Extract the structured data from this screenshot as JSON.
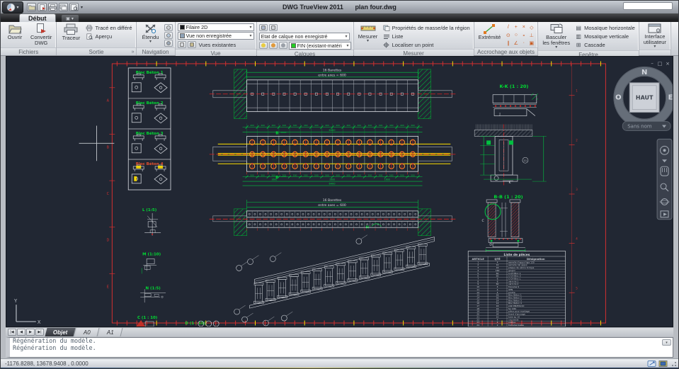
{
  "titlebar": {
    "app": "DWG TrueView 2011",
    "doc": "plan four.dwg"
  },
  "tabs": {
    "ribbon_tab": "Début"
  },
  "ribbon": {
    "fichiers": {
      "label": "Fichiers",
      "ouvrir": "Ouvrir",
      "convertir_1": "Convertir",
      "convertir_2": "DWG"
    },
    "sortie": {
      "label": "Sortie",
      "more": "»",
      "traceur": "Traceur",
      "trace": "Tracé en différé",
      "apercu": "Aperçu"
    },
    "navigation": {
      "label": "Navigation",
      "etendu": "Étendu"
    },
    "vue": {
      "label": "Vue",
      "style": "Filaire 2D",
      "vue_combo": "Vue non enregistrée",
      "existantes": "Vues existantes"
    },
    "calques": {
      "label": "Calques",
      "etat": "Etat de calque non enregistré",
      "calque": "FIN (existant-matéri",
      "layer_color": "#22cc22"
    },
    "mesurer": {
      "label": "Mesurer",
      "btn": "Mesurer",
      "props": "Propriétés de masse/de la région",
      "liste": "Liste",
      "localiser": "Localiser un point"
    },
    "accrochage": {
      "label": "Accrochage aux objets",
      "extremite": "Extrémité",
      "glyphs": [
        "/",
        "+",
        "×",
        "◇",
        "⊙",
        "○",
        "∘",
        "⊥",
        "∥",
        "∠",
        "·",
        "▣"
      ]
    },
    "fenetre": {
      "label": "Fenêtre",
      "basculer_1": "Basculer",
      "basculer_2": "les fenêtres",
      "items": [
        {
          "icon": "▤",
          "label": "Mosaïque horizontale"
        },
        {
          "icon": "▥",
          "label": "Mosaïque verticale"
        },
        {
          "icon": "⊞",
          "label": "Cascade"
        }
      ]
    },
    "interface": {
      "line1": "Interface",
      "line2": "utilisateur"
    }
  },
  "viewcube": {
    "n": "N",
    "e": "E",
    "s": "S",
    "o": "O",
    "center": "HAUT",
    "pill": "Sans nom"
  },
  "draw_win": {
    "min": "–",
    "restore": "□",
    "close": "×"
  },
  "drawing": {
    "blocs": [
      "Bloc Béton 1",
      "Bloc Béton 2",
      "Bloc Béton 3",
      "Bloc Béton 4"
    ],
    "zone_letters": [
      "A",
      "B",
      "C",
      "D",
      "E"
    ],
    "dim_top_1": "16 Barettes",
    "dim_top_2": "entre axes = 600",
    "dim_mid_1": "16 Barettes",
    "dim_mid_2": "entre axes = 600",
    "dims": {
      "seg_top": "400",
      "overall_top": "6400",
      "seg_bot": "500",
      "group": "1600",
      "overall_bot": "6400"
    },
    "labels": {
      "kk": "K-K (1 : 20)",
      "bb": "B-B (1 : 20)",
      "l": "L (1:5)",
      "m": "M (1:10)",
      "n": "N (1:5)",
      "c": "C (1 : 10)",
      "d": "D (1 : 10)",
      "b_marker": "B",
      "h_marker": "H",
      "j": "J",
      "k": "K",
      "c2": "C",
      "d2": "D",
      "circ11": "11"
    },
    "ucs": {
      "x": "X",
      "y": "Y"
    },
    "table": {
      "title": "Liste de pièces",
      "headers": [
        "ARTICLE",
        "QTÉ",
        "Désignation"
      ],
      "rows": [
        [
          "1",
          "4",
          "semelle d'appui tige 120"
        ],
        [
          "2",
          "10",
          "semelle rail appui"
        ],
        [
          "3",
          "16",
          "plaque de vérins torique"
        ],
        [
          "4",
          "160",
          "goujon"
        ],
        [
          "5",
          "60",
          "C-CH Bloc 1"
        ],
        [
          "6",
          "60",
          "C-CH Bloc 3"
        ],
        [
          "7",
          "6",
          "C-CH Bloc L"
        ],
        [
          "8",
          "6",
          "vérin té 1"
        ],
        [
          "9",
          "60",
          "vérin té 2"
        ],
        [
          "10",
          "4",
          "traverse S"
        ],
        [
          "11",
          "4",
          "UPN"
        ],
        [
          "12",
          "4",
          "poutre"
        ],
        [
          "13",
          "26",
          "Bloc Béton 1"
        ],
        [
          "14",
          "56",
          "Bloc Béton 2"
        ],
        [
          "15",
          "14",
          "Bloc Béton 3"
        ],
        [
          "16",
          "14",
          "Bloc Béton 4"
        ],
        [
          "17",
          "16",
          "plat DN450x10"
        ],
        [
          "18",
          "16",
          "fer U80"
        ],
        [
          "19",
          "16",
          "pièce pour montage"
        ],
        [
          "20",
          "34",
          "tirant d'ancrage"
        ],
        [
          "21",
          "10",
          "tube ep 10"
        ],
        [
          "22",
          "4",
          "couvercle"
        ],
        [
          "23",
          "4",
          "plaque"
        ],
        [
          "24",
          "2",
          "traverse basse"
        ]
      ]
    }
  },
  "bottom": {
    "nav_buttons": [
      "|◀",
      "◀",
      "▶",
      "▶|"
    ],
    "layout_tabs": [
      "Objet",
      "A0",
      "A1"
    ],
    "command_lines": [
      "Régénération du modèle.",
      "Régénération du modèle."
    ],
    "coords": "-1176.8288, 13678.9408 , 0.0000"
  }
}
